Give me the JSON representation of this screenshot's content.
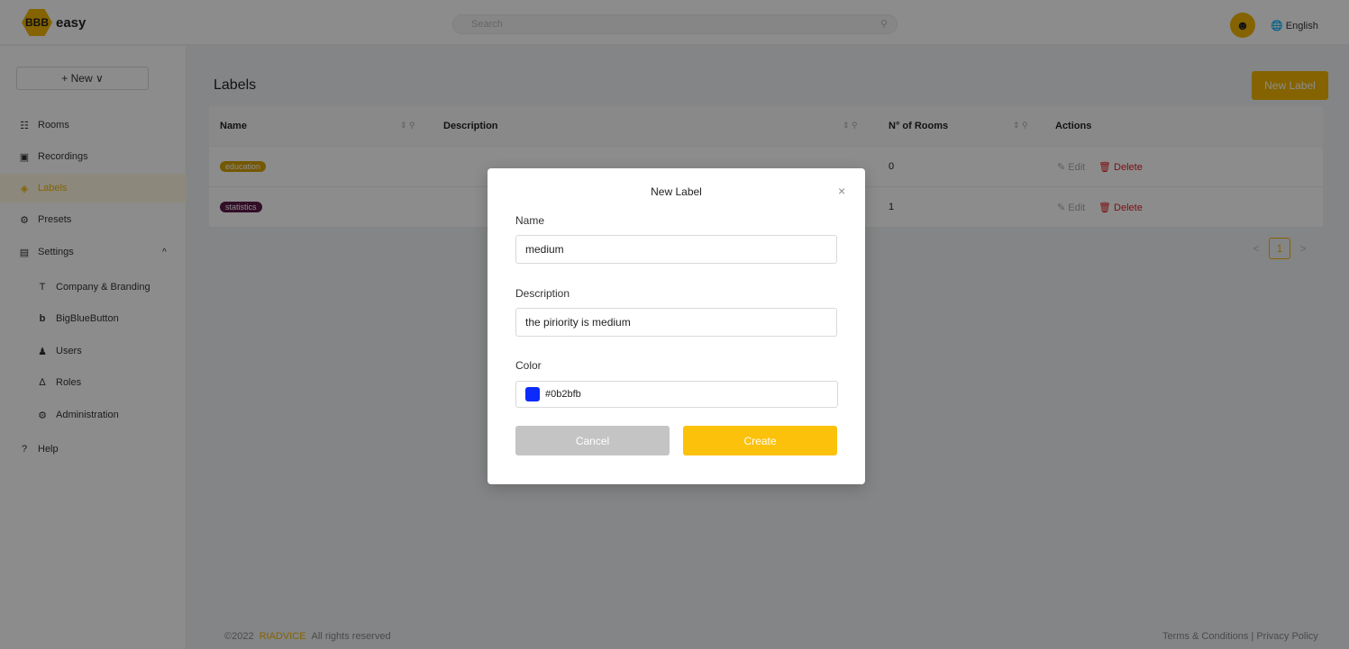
{
  "header": {
    "logo_mark": "BBB",
    "logo_text": "easy",
    "search_placeholder": "Search",
    "language": "English"
  },
  "sidebar": {
    "new_button": "+ New ∨",
    "items": [
      {
        "label": "Rooms",
        "icon": "rooms-icon"
      },
      {
        "label": "Recordings",
        "icon": "recordings-icon"
      },
      {
        "label": "Labels",
        "icon": "label-icon",
        "active": true
      },
      {
        "label": "Presets",
        "icon": "presets-icon"
      },
      {
        "label": "Settings",
        "icon": "settings-icon"
      },
      {
        "label": "Company & Branding",
        "icon": "paint-roller-icon"
      },
      {
        "label": "BigBlueButton",
        "icon": "bigbluebutton-icon"
      },
      {
        "label": "Users",
        "icon": "users-icon"
      },
      {
        "label": "Roles",
        "icon": "roles-icon"
      },
      {
        "label": "Administration",
        "icon": "gear-icon"
      },
      {
        "label": "Help",
        "icon": "help-icon"
      }
    ]
  },
  "main": {
    "title": "Labels",
    "new_label_button": "New Label",
    "columns": [
      "Name",
      "Description",
      "N° of Rooms",
      "Actions"
    ],
    "rows": [
      {
        "name": "education",
        "color": "#d4a106",
        "description": "",
        "rooms": "0"
      },
      {
        "name": "statistics",
        "color": "#5c1a48",
        "description": "",
        "rooms": "1"
      }
    ],
    "edit_label": "Edit",
    "delete_label": "Delete",
    "pagination": {
      "prev": "<",
      "current": "1",
      "next": ">"
    }
  },
  "footer": {
    "copyright": "©2022",
    "brand": "RIADVICE",
    "rights": "All rights reserved",
    "links": "Terms & Conditions | Privacy Policy"
  },
  "modal": {
    "title": "New Label",
    "close_symbol": "×",
    "name_label": "Name",
    "name_value": "medium",
    "description_label": "Description",
    "description_value": "the piriority is medium",
    "color_label": "Color",
    "color_value": "#0b2bfb",
    "cancel": "Cancel",
    "create": "Create"
  }
}
